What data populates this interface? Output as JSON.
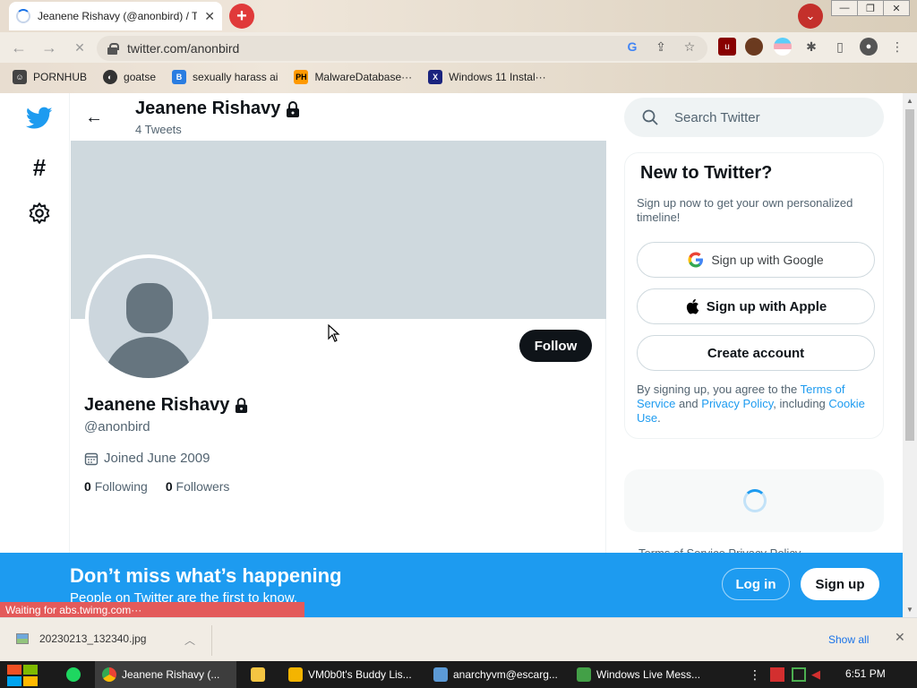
{
  "browser": {
    "tab_title": "Jeanene Rishavy (@anonbird) / Twitter",
    "tab_close": "✕",
    "url": "twitter.com/anonbird",
    "bookmarks": [
      {
        "label": "PORNHUB",
        "icon": "ph-icon"
      },
      {
        "label": "goatse",
        "icon": "globe-icon"
      },
      {
        "label": "sexually harass ai",
        "icon": "chat-icon"
      },
      {
        "label": "MalwareDatabase···",
        "icon": "ph-icon"
      },
      {
        "label": "Windows 11 Instal···",
        "icon": "x-icon"
      }
    ]
  },
  "profile": {
    "header_name": "Jeanene Rishavy",
    "tweet_count": "4 Tweets",
    "name": "Jeanene Rishavy",
    "handle": "@anonbird",
    "joined": "Joined June 2009",
    "following_count": "0",
    "following_label": "Following",
    "followers_count": "0",
    "followers_label": "Followers",
    "follow_button": "Follow"
  },
  "sidebar": {
    "search_placeholder": "Search Twitter",
    "new_title": "New to Twitter?",
    "new_sub": "Sign up now to get your own personalized timeline!",
    "google_btn": "Sign up with Google",
    "apple_btn": "Sign up with Apple",
    "create_btn": "Create account",
    "terms_pre": "By signing up, you agree to the ",
    "terms_link": "Terms of Service",
    "terms_mid": " and ",
    "privacy_link": "Privacy Policy",
    "terms_mid2": ", including ",
    "cookie_link": "Cookie Use",
    "terms_end": ".",
    "footer_links": "Terms of Service   Privacy Policy"
  },
  "banner_bar": {
    "title": "Don’t miss what’s happening",
    "subtitle": "People on Twitter are the first to know.",
    "login": "Log in",
    "signup": "Sign up"
  },
  "status_text": "Waiting for abs.twimg.com···",
  "downloads": {
    "file": "20230213_132340.jpg",
    "show_all": "Show all"
  },
  "taskbar": {
    "tasks": [
      "Jeanene Rishavy (...",
      "VM0b0t's Buddy Lis...",
      "anarchyvm@escarg...",
      "Windows Live Mess..."
    ],
    "clock": "6:51 PM"
  },
  "colors": {
    "twitter_blue": "#1d9bf0",
    "banner_gray": "#cfd9de",
    "dark": "#0f1419"
  }
}
